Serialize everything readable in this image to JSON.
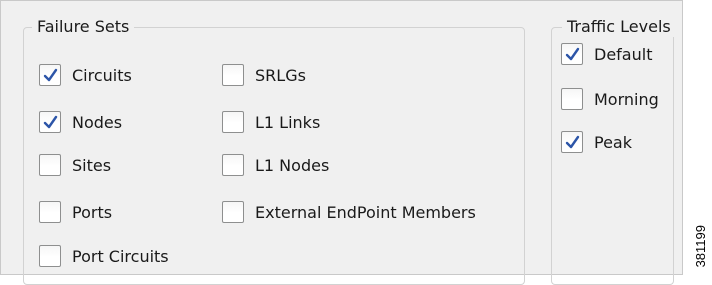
{
  "failure_sets": {
    "title": "Failure Sets",
    "items": [
      {
        "label": "Circuits",
        "checked": true
      },
      {
        "label": "Nodes",
        "checked": true
      },
      {
        "label": "Sites",
        "checked": false
      },
      {
        "label": "Ports",
        "checked": false
      },
      {
        "label": "Port Circuits",
        "checked": false
      },
      {
        "label": "SRLGs",
        "checked": false
      },
      {
        "label": "L1 Links",
        "checked": false
      },
      {
        "label": "L1 Nodes",
        "checked": false
      },
      {
        "label": "External EndPoint Members",
        "checked": false
      }
    ]
  },
  "traffic_levels": {
    "title": "Traffic Levels",
    "items": [
      {
        "label": "Default",
        "checked": true
      },
      {
        "label": "Morning",
        "checked": false
      },
      {
        "label": "Peak",
        "checked": true
      }
    ]
  },
  "figure_number": "381199",
  "colors": {
    "panel_background": "#f0f0f0",
    "checkmark": "#2c55a8",
    "checkbox_border": "#8e8f8f",
    "group_border": "#d2d2d2"
  }
}
